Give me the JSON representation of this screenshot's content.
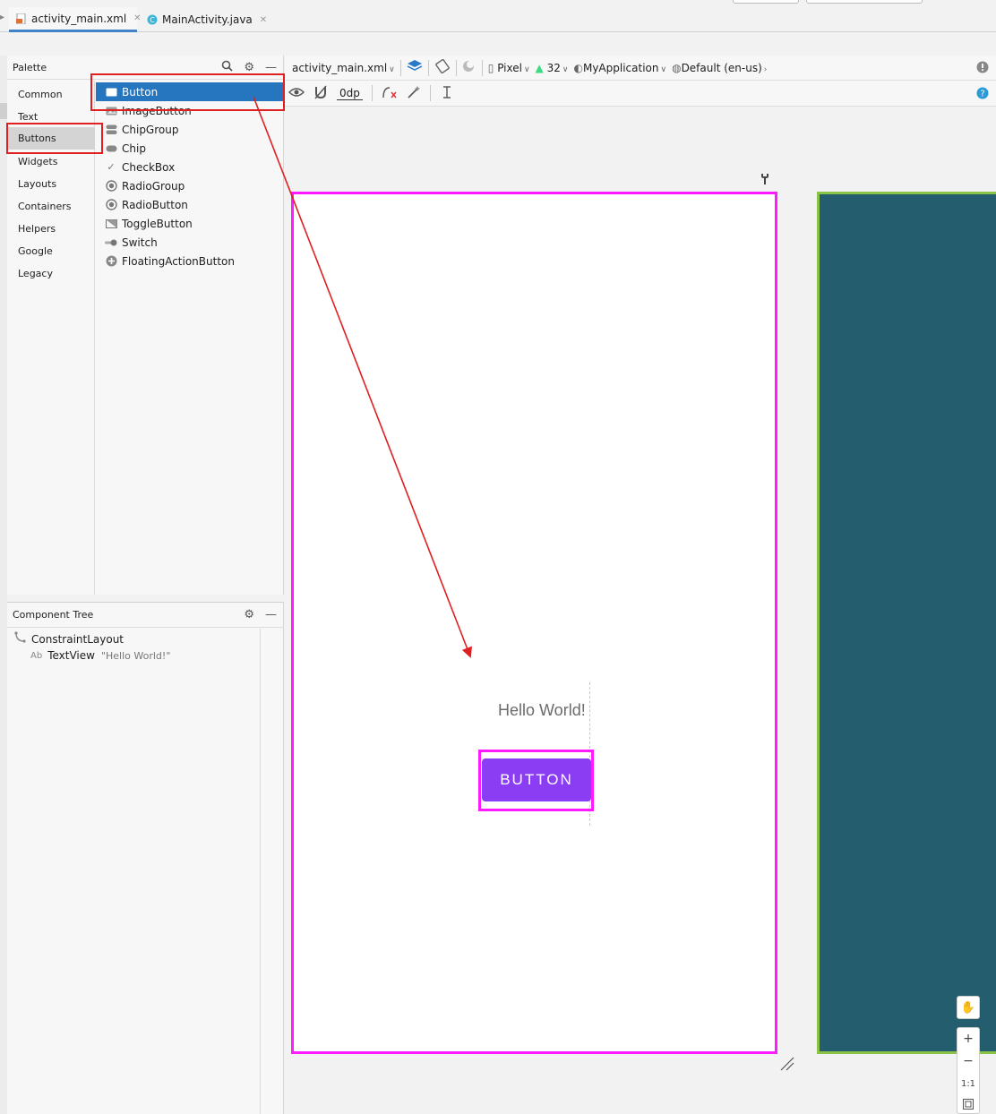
{
  "tabs": [
    {
      "label": "activity_main.xml",
      "active": true
    },
    {
      "label": "MainActivity.java",
      "active": false
    }
  ],
  "palette": {
    "title": "Palette",
    "categories": [
      "Common",
      "Text",
      "Buttons",
      "Widgets",
      "Layouts",
      "Containers",
      "Helpers",
      "Google",
      "Legacy"
    ],
    "selected_category": "Buttons",
    "items": [
      {
        "label": "Button",
        "icon": "button-icon"
      },
      {
        "label": "ImageButton",
        "icon": "image-button-icon"
      },
      {
        "label": "ChipGroup",
        "icon": "chip-group-icon"
      },
      {
        "label": "Chip",
        "icon": "chip-icon"
      },
      {
        "label": "CheckBox",
        "icon": "checkbox-icon"
      },
      {
        "label": "RadioGroup",
        "icon": "radio-group-icon"
      },
      {
        "label": "RadioButton",
        "icon": "radio-button-icon"
      },
      {
        "label": "ToggleButton",
        "icon": "toggle-button-icon"
      },
      {
        "label": "Switch",
        "icon": "switch-icon"
      },
      {
        "label": "FloatingActionButton",
        "icon": "fab-icon"
      }
    ],
    "selected_item": "Button"
  },
  "component_tree": {
    "title": "Component Tree",
    "root": "ConstraintLayout",
    "child": {
      "prefix": "Ab",
      "label": "TextView",
      "value": "\"Hello World!\""
    }
  },
  "toolbar": {
    "file": "activity_main.xml",
    "device": "Pixel",
    "api": "32",
    "theme": "MyApplication",
    "locale": "Default (en-us)",
    "margin": "0dp"
  },
  "canvas": {
    "hello_text": "Hello World!",
    "button_text": "BUTTON"
  },
  "zoom": {
    "plus": "+",
    "minus": "−",
    "one_to_one": "1:1"
  },
  "colors": {
    "selection": "#ff1aff",
    "button": "#8a3df2",
    "blueprint": "#235d6e",
    "blueprint_border": "#8bc34a",
    "palette_selected": "#2675bf",
    "annotation": "#e02020"
  }
}
